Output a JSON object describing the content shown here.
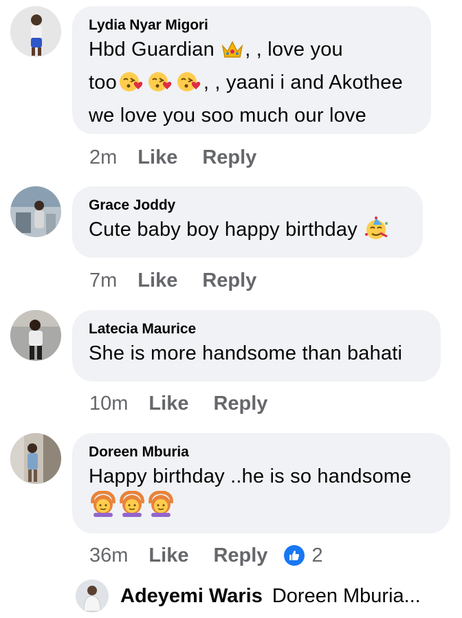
{
  "comments": [
    {
      "author": "Lydia Nyar Migori",
      "lines": [
        [
          "Hbd Guardian ",
          ", ,    love you"
        ],
        [
          "too",
          ", , yaani i and Akothee"
        ],
        [
          "we love you soo much our love"
        ]
      ],
      "time": "2m",
      "like": "Like",
      "reply": "Reply"
    },
    {
      "author": "Grace Joddy",
      "text": "Cute baby boy happy birthday ",
      "time": "7m",
      "like": "Like",
      "reply": "Reply"
    },
    {
      "author": "Latecia Maurice",
      "text": "She is more handsome than bahati",
      "time": "10m",
      "like": "Like",
      "reply": "Reply"
    },
    {
      "author": "Doreen Mburia",
      "text": "Happy birthday ..he is so handsome",
      "time": "36m",
      "like": "Like",
      "reply": "Reply",
      "reaction_count": "2",
      "reaction_type": "like-icon"
    }
  ],
  "reply_preview": {
    "author": "Adeyemi Waris",
    "text": "Doreen Mburia..."
  },
  "colors": {
    "bubble": "#f0f2f5",
    "meta": "#65676b",
    "like_blue": "#1877f2"
  }
}
